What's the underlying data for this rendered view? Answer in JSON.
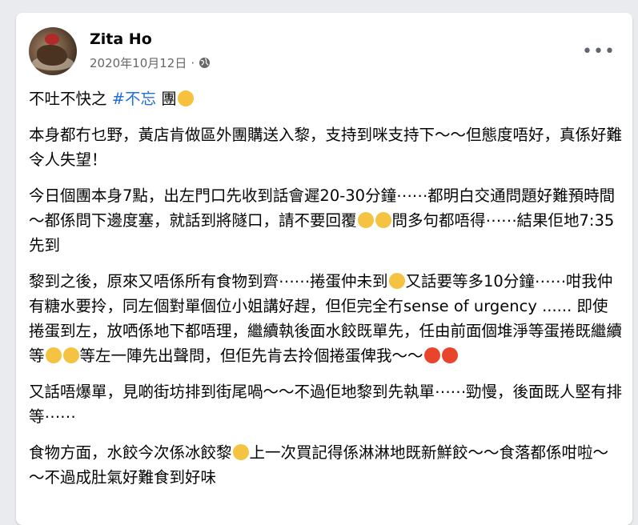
{
  "author": {
    "name": "Zita Ho",
    "date": "2020年10月12日",
    "privacy_icon": "globe-icon"
  },
  "more_label": "•••",
  "dot": "·",
  "post": {
    "p1": {
      "a": "不吐不快之 ",
      "hashtag": "#不忘",
      "b": " 團"
    },
    "p2": {
      "a": "本身都冇乜野，黃店肯做區外團購送入黎，支持到咪支持下～～但態度唔好，真係好難令人失望！"
    },
    "p3": {
      "a": "今日個團本身7點，出左門口先收到話會遲20-30分鐘⋯⋯都明白交通問題好難預時間～都係問下邊度塞，就話到將隧口，請不要回覆",
      "b": "問多句都唔得⋯⋯結果佢地7:35 先到"
    },
    "p4": {
      "a": "黎到之後，原來又唔係所有食物到齊⋯⋯捲蛋仲未到",
      "b": "又話要等多10分鐘⋯⋯咁我仲有糖水要拎，同左個對單個位小姐講好趕，但佢完全冇sense of urgency ...... 即使捲蛋到左，放哂係地下都唔理，繼續執後面水餃既單先，任由前面個堆淨等蛋捲既繼續等",
      "c": "等左一陣先出聲問，但佢先肯去拎個捲蛋俾我～～"
    },
    "p5": {
      "a": "又話唔爆單，見啲街坊排到街尾喎～～不過佢地黎到先執單⋯⋯勁慢，後面既人堅有排等⋯⋯"
    },
    "p6": {
      "a": "食物方面，水餃今次係冰餃黎",
      "b": "上一次買記得係淋淋地既新鮮餃～～食落都係咁啦～～不過成肚氣好難食到好味"
    }
  },
  "emojis": {
    "steam": "face-with-steam-icon",
    "eyeroll": "eye-roll-icon",
    "sweat": "anxious-sweat-icon",
    "mind": "exploding-head-icon",
    "angry": "angry-face-icon",
    "think": "thinking-face-icon"
  }
}
